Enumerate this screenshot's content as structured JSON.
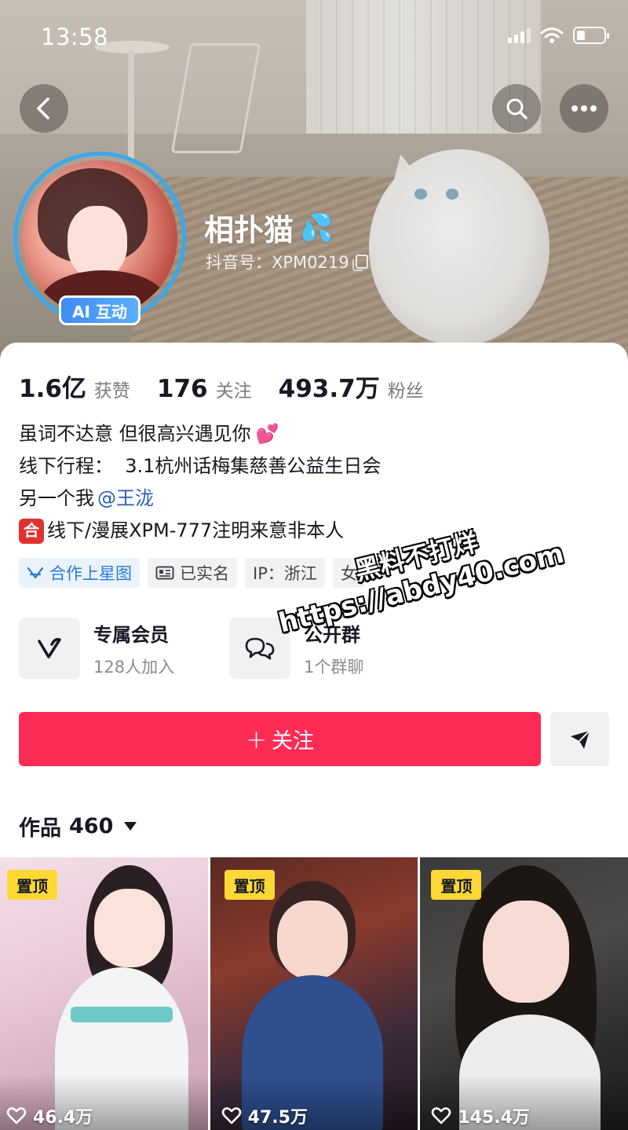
{
  "status_bar": {
    "time": "13:58",
    "battery_level": 0.3
  },
  "profile": {
    "name": "相扑猫",
    "name_emoji": "💦",
    "douyin_id": "抖音号：XPM0219",
    "ai_badge": "AI 互动"
  },
  "stats": [
    {
      "value": "1.6亿",
      "label": "获赞"
    },
    {
      "value": "176",
      "label": "关注"
    },
    {
      "value": "493.7万",
      "label": "粉丝"
    }
  ],
  "bio": {
    "line1": "虽词不达意 但很高兴遇见你",
    "line1_emoji": "💕",
    "line2": "线下行程：  3.1杭州话梅集慈善公益生日会",
    "line3_prefix": "另一个我",
    "line3_mention": "@王泷",
    "line4_badge": "合",
    "line4": "线下/漫展XPM-777注明来意非本人"
  },
  "tags": [
    {
      "label": "合作上星图",
      "icon": "star-map-icon"
    },
    {
      "label": "已实名",
      "icon": "id-card-icon"
    },
    {
      "label": "IP：浙江"
    },
    {
      "label": "女"
    }
  ],
  "features": {
    "membership": {
      "title": "专属会员",
      "subtitle": "128人加入",
      "icon": "v-icon"
    },
    "group": {
      "title": "公开群",
      "subtitle": "1个群聊",
      "icon": "chat-bubbles-icon"
    }
  },
  "actions": {
    "follow_label": "关注",
    "follow_icon": "+"
  },
  "works": {
    "label": "作品",
    "count": "460"
  },
  "watermark": {
    "line1": "黑料不打烊",
    "line2": "https://abdy40.com"
  },
  "videos": [
    {
      "pinned_label": "置顶",
      "likes": "46.4万"
    },
    {
      "pinned_label": "置顶",
      "likes": "47.5万"
    },
    {
      "pinned_label": "置顶",
      "likes": "145.4万"
    }
  ],
  "colors": {
    "accent": "#fe2c55",
    "avatar_ring": "#3aa8ec",
    "pin_badge": "#fdd835",
    "mention": "#2c5db5"
  }
}
